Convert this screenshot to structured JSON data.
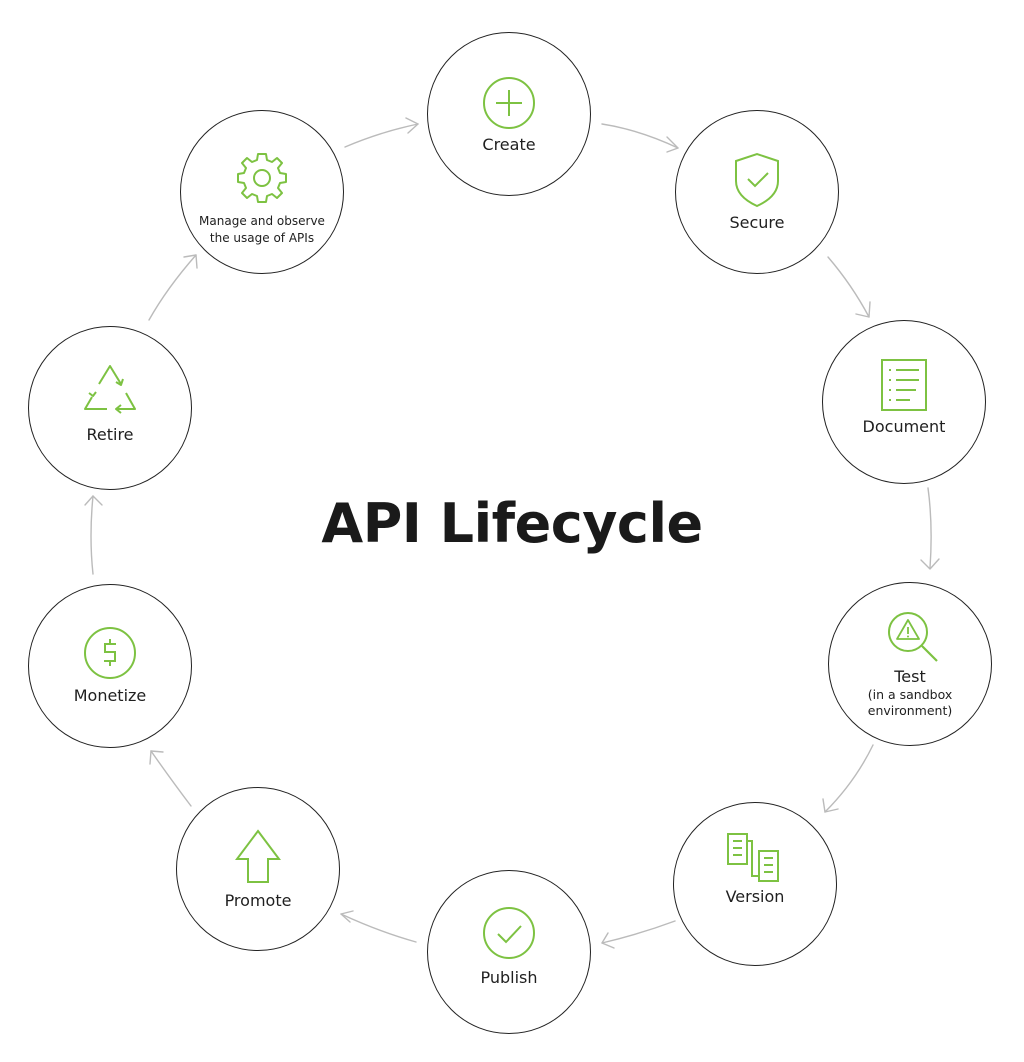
{
  "title": "API Lifecycle",
  "colors": {
    "accent": "#7dc242",
    "circle_stroke": "#222222",
    "arrow": "#bbbbbb",
    "text": "#1f1f1f"
  },
  "nodes": [
    {
      "id": "create",
      "label": "Create",
      "icon": "plus-circle-icon"
    },
    {
      "id": "secure",
      "label": "Secure",
      "icon": "shield-check-icon"
    },
    {
      "id": "document",
      "label": "Document",
      "icon": "document-list-icon"
    },
    {
      "id": "test",
      "label": "Test",
      "sublabel_line1": "(in a sandbox",
      "sublabel_line2": "environment)",
      "icon": "magnifier-warning-icon"
    },
    {
      "id": "version",
      "label": "Version",
      "icon": "versions-documents-icon"
    },
    {
      "id": "publish",
      "label": "Publish",
      "icon": "check-circle-icon"
    },
    {
      "id": "promote",
      "label": "Promote",
      "icon": "arrow-up-icon"
    },
    {
      "id": "monetize",
      "label": "Monetize",
      "icon": "dollar-circle-icon"
    },
    {
      "id": "retire",
      "label": "Retire",
      "icon": "recycle-icon"
    },
    {
      "id": "manage",
      "label_line1": "Manage and observe",
      "label_line2": "the usage of APIs",
      "icon": "gear-icon"
    }
  ],
  "flow": [
    "create",
    "secure",
    "document",
    "test",
    "version",
    "publish",
    "promote",
    "monetize",
    "retire",
    "manage",
    "create"
  ]
}
